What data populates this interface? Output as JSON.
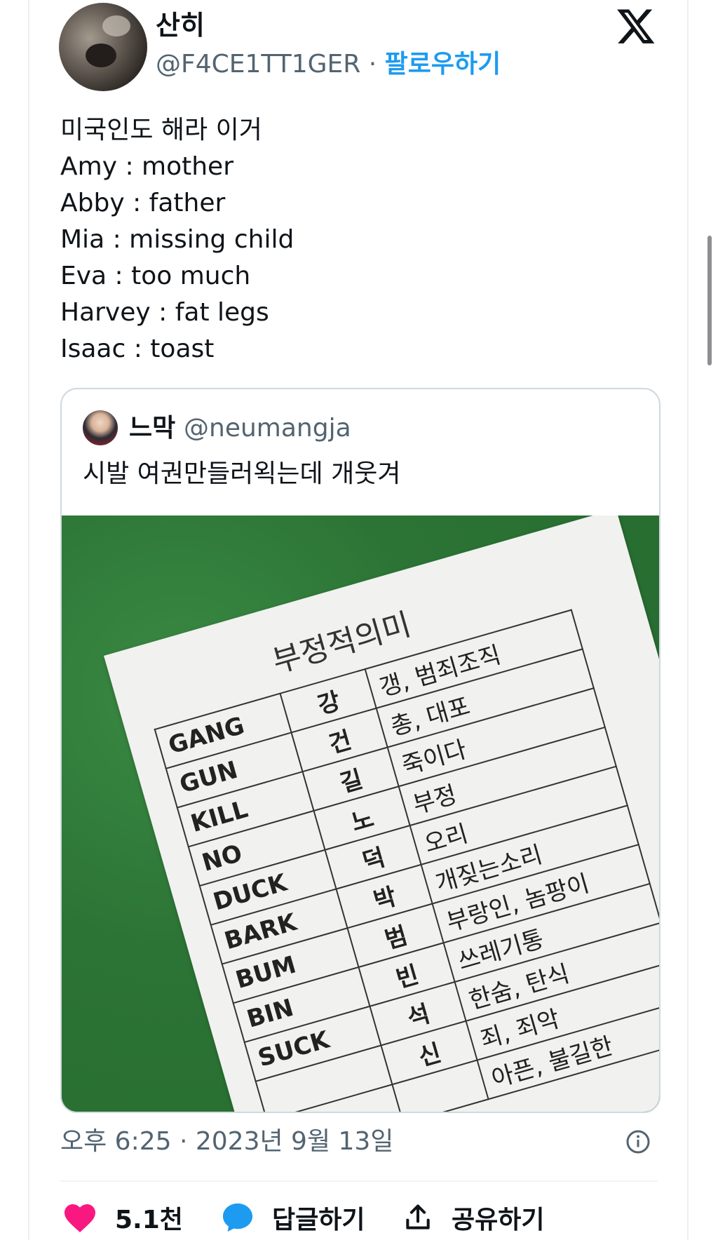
{
  "author": {
    "name": "산히",
    "handle": "@F4CE1TT1GER",
    "separator": "·",
    "follow_label": "팔로우하기"
  },
  "tweet": {
    "lines": [
      "미국인도 해라 이거",
      "Amy : mother",
      "Abby : father",
      "Mia : missing child",
      "Eva : too much",
      "Harvey : fat legs",
      "Isaac : toast"
    ]
  },
  "quote": {
    "name": "느막",
    "handle": "@neumangja",
    "text": "시발 여권만들러왹는데 개웃겨",
    "photo": {
      "title": "부정적의미",
      "rows": [
        {
          "en": "GANG",
          "ko": "강",
          "meaning": "갱, 범죄조직"
        },
        {
          "en": "GUN",
          "ko": "건",
          "meaning": "총, 대포"
        },
        {
          "en": "KILL",
          "ko": "길",
          "meaning": "죽이다"
        },
        {
          "en": "NO",
          "ko": "노",
          "meaning": "부정"
        },
        {
          "en": "DUCK",
          "ko": "덕",
          "meaning": "오리"
        },
        {
          "en": "BARK",
          "ko": "박",
          "meaning": "개짖는소리"
        },
        {
          "en": "BUM",
          "ko": "범",
          "meaning": "부랑인, 놈팡이"
        },
        {
          "en": "BIN",
          "ko": "빈",
          "meaning": "쓰레기통"
        },
        {
          "en": "SUCK",
          "ko": "석",
          "meaning": "한숨, 탄식"
        },
        {
          "en": "",
          "ko": "신",
          "meaning": "죄, 죄악"
        },
        {
          "en": "",
          "ko": "",
          "meaning": "아픈, 불길한"
        }
      ]
    }
  },
  "meta": {
    "timestamp": "오후 6:25 · 2023년 9월 13일"
  },
  "actions": {
    "like_count": "5.1천",
    "reply_label": "답글하기",
    "share_label": "공유하기"
  },
  "colors": {
    "accent": "#1d9bf0",
    "like": "#f91880",
    "muted": "#536471"
  },
  "icons": [
    "x-logo-icon",
    "info-icon",
    "heart-icon",
    "reply-bubble-icon",
    "share-icon"
  ]
}
